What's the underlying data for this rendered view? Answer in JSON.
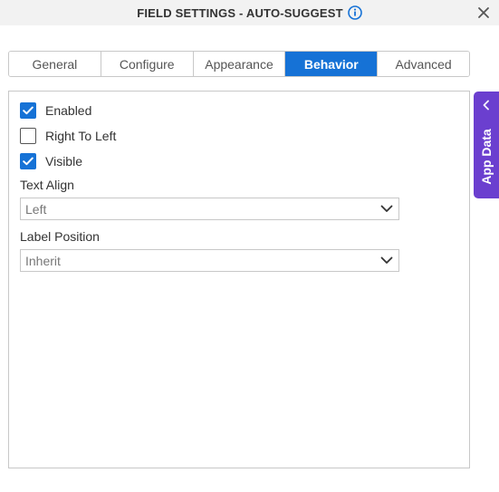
{
  "header": {
    "title": "FIELD SETTINGS - AUTO-SUGGEST",
    "info_icon": "info-icon",
    "close_icon": "close-icon"
  },
  "tabs": [
    {
      "label": "General",
      "active": false
    },
    {
      "label": "Configure",
      "active": false
    },
    {
      "label": "Appearance",
      "active": false
    },
    {
      "label": "Behavior",
      "active": true
    },
    {
      "label": "Advanced",
      "active": false
    }
  ],
  "behavior": {
    "enabled": {
      "label": "Enabled",
      "checked": true
    },
    "right_to_left": {
      "label": "Right To Left",
      "checked": false
    },
    "visible": {
      "label": "Visible",
      "checked": true
    },
    "text_align": {
      "label": "Text Align",
      "value": "Left"
    },
    "label_position": {
      "label": "Label Position",
      "value": "Inherit"
    }
  },
  "side_panel": {
    "label": "App Data",
    "icon": "chevron-left-icon"
  },
  "colors": {
    "accent": "#1672d6",
    "side_panel": "#6b3fcf",
    "header_bg": "#f2f2f2"
  }
}
